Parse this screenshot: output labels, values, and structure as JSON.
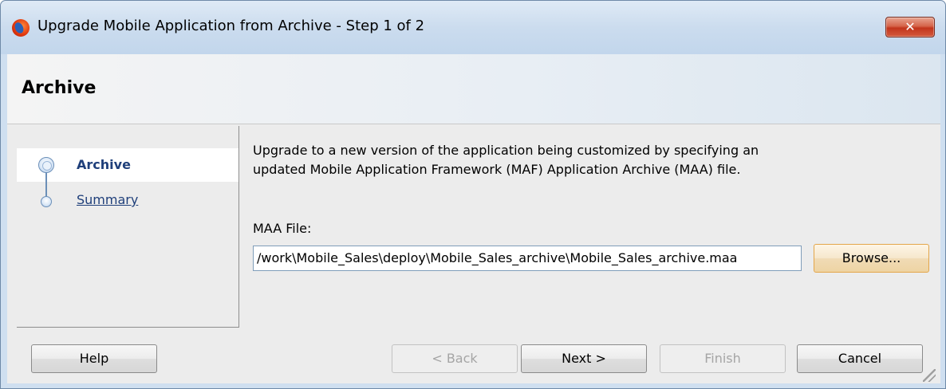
{
  "window": {
    "title": "Upgrade Mobile Application from Archive - Step 1 of 2",
    "close_glyph": "✕"
  },
  "header": {
    "title": "Archive"
  },
  "nav": {
    "items": [
      {
        "label": "Archive",
        "selected": true
      },
      {
        "label": "Summary",
        "selected": false
      }
    ]
  },
  "main": {
    "description": "Upgrade to a new version of the application being customized by specifying an updated Mobile Application Framework (MAF) Application Archive (MAA) file.",
    "maa_label": "MAA File:",
    "maa_value": "/work\\Mobile_Sales\\deploy\\Mobile_Sales_archive\\Mobile_Sales_archive.maa",
    "browse_label": "Browse..."
  },
  "footer": {
    "help_label": "Help",
    "back_label": "< Back",
    "next_label": "Next >",
    "finish_label": "Finish",
    "cancel_label": "Cancel"
  },
  "colors": {
    "title_bar": "#c8daee",
    "close_button": "#c9452b",
    "link": "#1f3f7a",
    "focus_border": "#e3a64a"
  }
}
